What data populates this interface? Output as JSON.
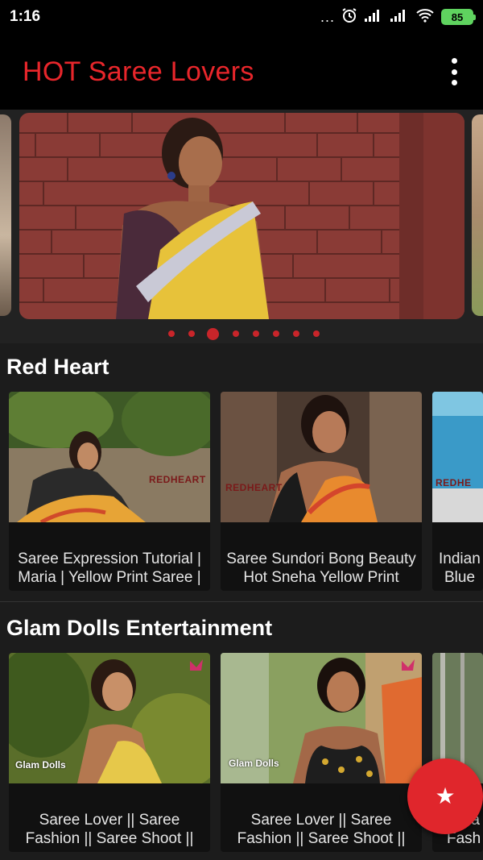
{
  "status_bar": {
    "time": "1:16",
    "battery": "85",
    "more_dots": "..."
  },
  "app_bar": {
    "title": "HOT Saree Lovers",
    "title_color": "#e8262b"
  },
  "carousel": {
    "page_count": 8,
    "active_index": 2,
    "accent": "#c9252a"
  },
  "sections": [
    {
      "title": "Red Heart",
      "cards": [
        {
          "line1": "Saree Expression Tutorial |",
          "line2": "Maria | Yellow Print Saree |",
          "watermark": "REDHEART"
        },
        {
          "line1": "Saree Sundori Bong Beauty",
          "line2": "Hot Sneha Yellow Print",
          "watermark": "REDHEART"
        },
        {
          "line1": "Indian",
          "line2": "Blue",
          "watermark": "REDHE"
        }
      ]
    },
    {
      "title": "Glam Dolls Entertainment",
      "cards": [
        {
          "line1": "Saree Lover || Saree",
          "line2": "Fashion || Saree Shoot ||",
          "watermark": "Glam Dolls"
        },
        {
          "line1": "Saree Lover || Saree",
          "line2": "Fashion || Saree Shoot ||",
          "watermark": "Glam Dolls"
        },
        {
          "line1": "a",
          "line2": "Fash",
          "watermark": ""
        }
      ]
    }
  ],
  "fab": {
    "icon": "star-icon",
    "color": "#e0262c"
  }
}
